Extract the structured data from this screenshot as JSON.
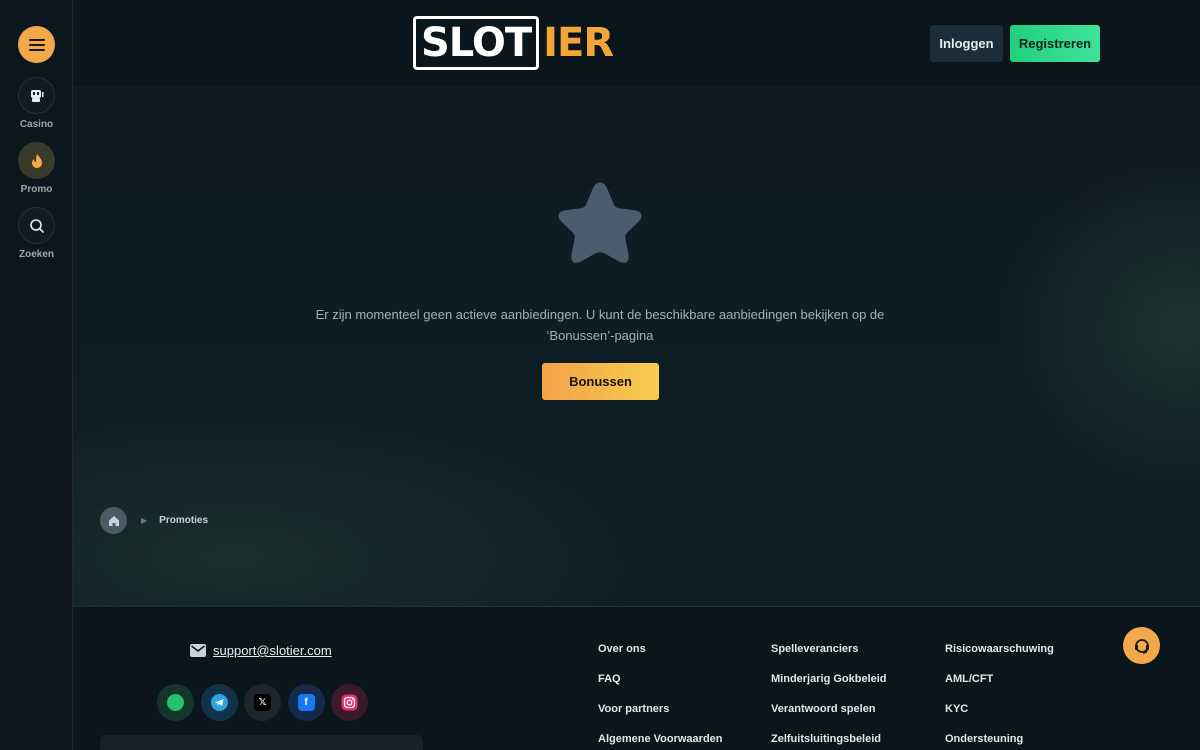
{
  "sidebar": {
    "items": [
      {
        "label": "Casino",
        "icon": "slot-machine-icon"
      },
      {
        "label": "Promo",
        "icon": "flame-icon"
      },
      {
        "label": "Zoeken",
        "icon": "search-icon"
      }
    ]
  },
  "header": {
    "logo_part1": "SLOT",
    "logo_part2": "IER",
    "login_label": "Inloggen",
    "register_label": "Registreren"
  },
  "main": {
    "empty_line1": "Er zijn momenteel geen actieve aanbiedingen. U kunt de beschikbare aanbiedingen bekijken op de",
    "empty_line2": "‘Bonussen’-pagina",
    "bonus_button": "Bonussen",
    "breadcrumb_label": "Promoties"
  },
  "footer": {
    "email": "support@slotier.com",
    "socials": [
      "whatsapp-icon",
      "telegram-icon",
      "x-icon",
      "facebook-icon",
      "instagram-icon"
    ],
    "col1": [
      "Over ons",
      "FAQ",
      "Voor partners",
      "Algemene Voorwaarden"
    ],
    "col2": [
      "Spelleveranciers",
      "Minderjarig Gokbeleid",
      "Verantwoord spelen",
      "Zelfuitsluitingsbeleid"
    ],
    "col3": [
      "Risicowaarschuwing",
      "AML/CFT",
      "KYC",
      "Ondersteuning"
    ]
  },
  "colors": {
    "accent": "#f3a94a",
    "register": "#2fd98a",
    "background": "#0e1b22"
  }
}
